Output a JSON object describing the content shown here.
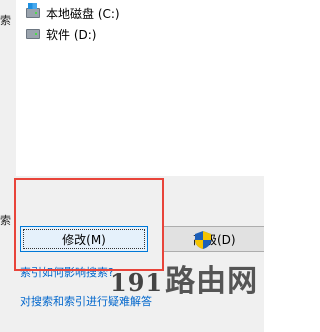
{
  "drives": [
    {
      "label": "本地磁盘 (C:)",
      "icon": "system-drive-icon"
    },
    {
      "label": "软件 (D:)",
      "icon": "drive-icon"
    }
  ],
  "left_fragments": [
    "索",
    "索"
  ],
  "buttons": {
    "modify": "修改(M)",
    "advanced": "高级(D)"
  },
  "links": {
    "how_index_affects_search": "索引如何影响搜索?",
    "troubleshoot": "对搜索和索引进行疑难解答"
  },
  "watermark": {
    "digits": "191",
    "text": "路由网"
  },
  "colors": {
    "highlight_border": "#e8443a",
    "link": "#0066cc",
    "focus_button_border": "#0078d7"
  }
}
